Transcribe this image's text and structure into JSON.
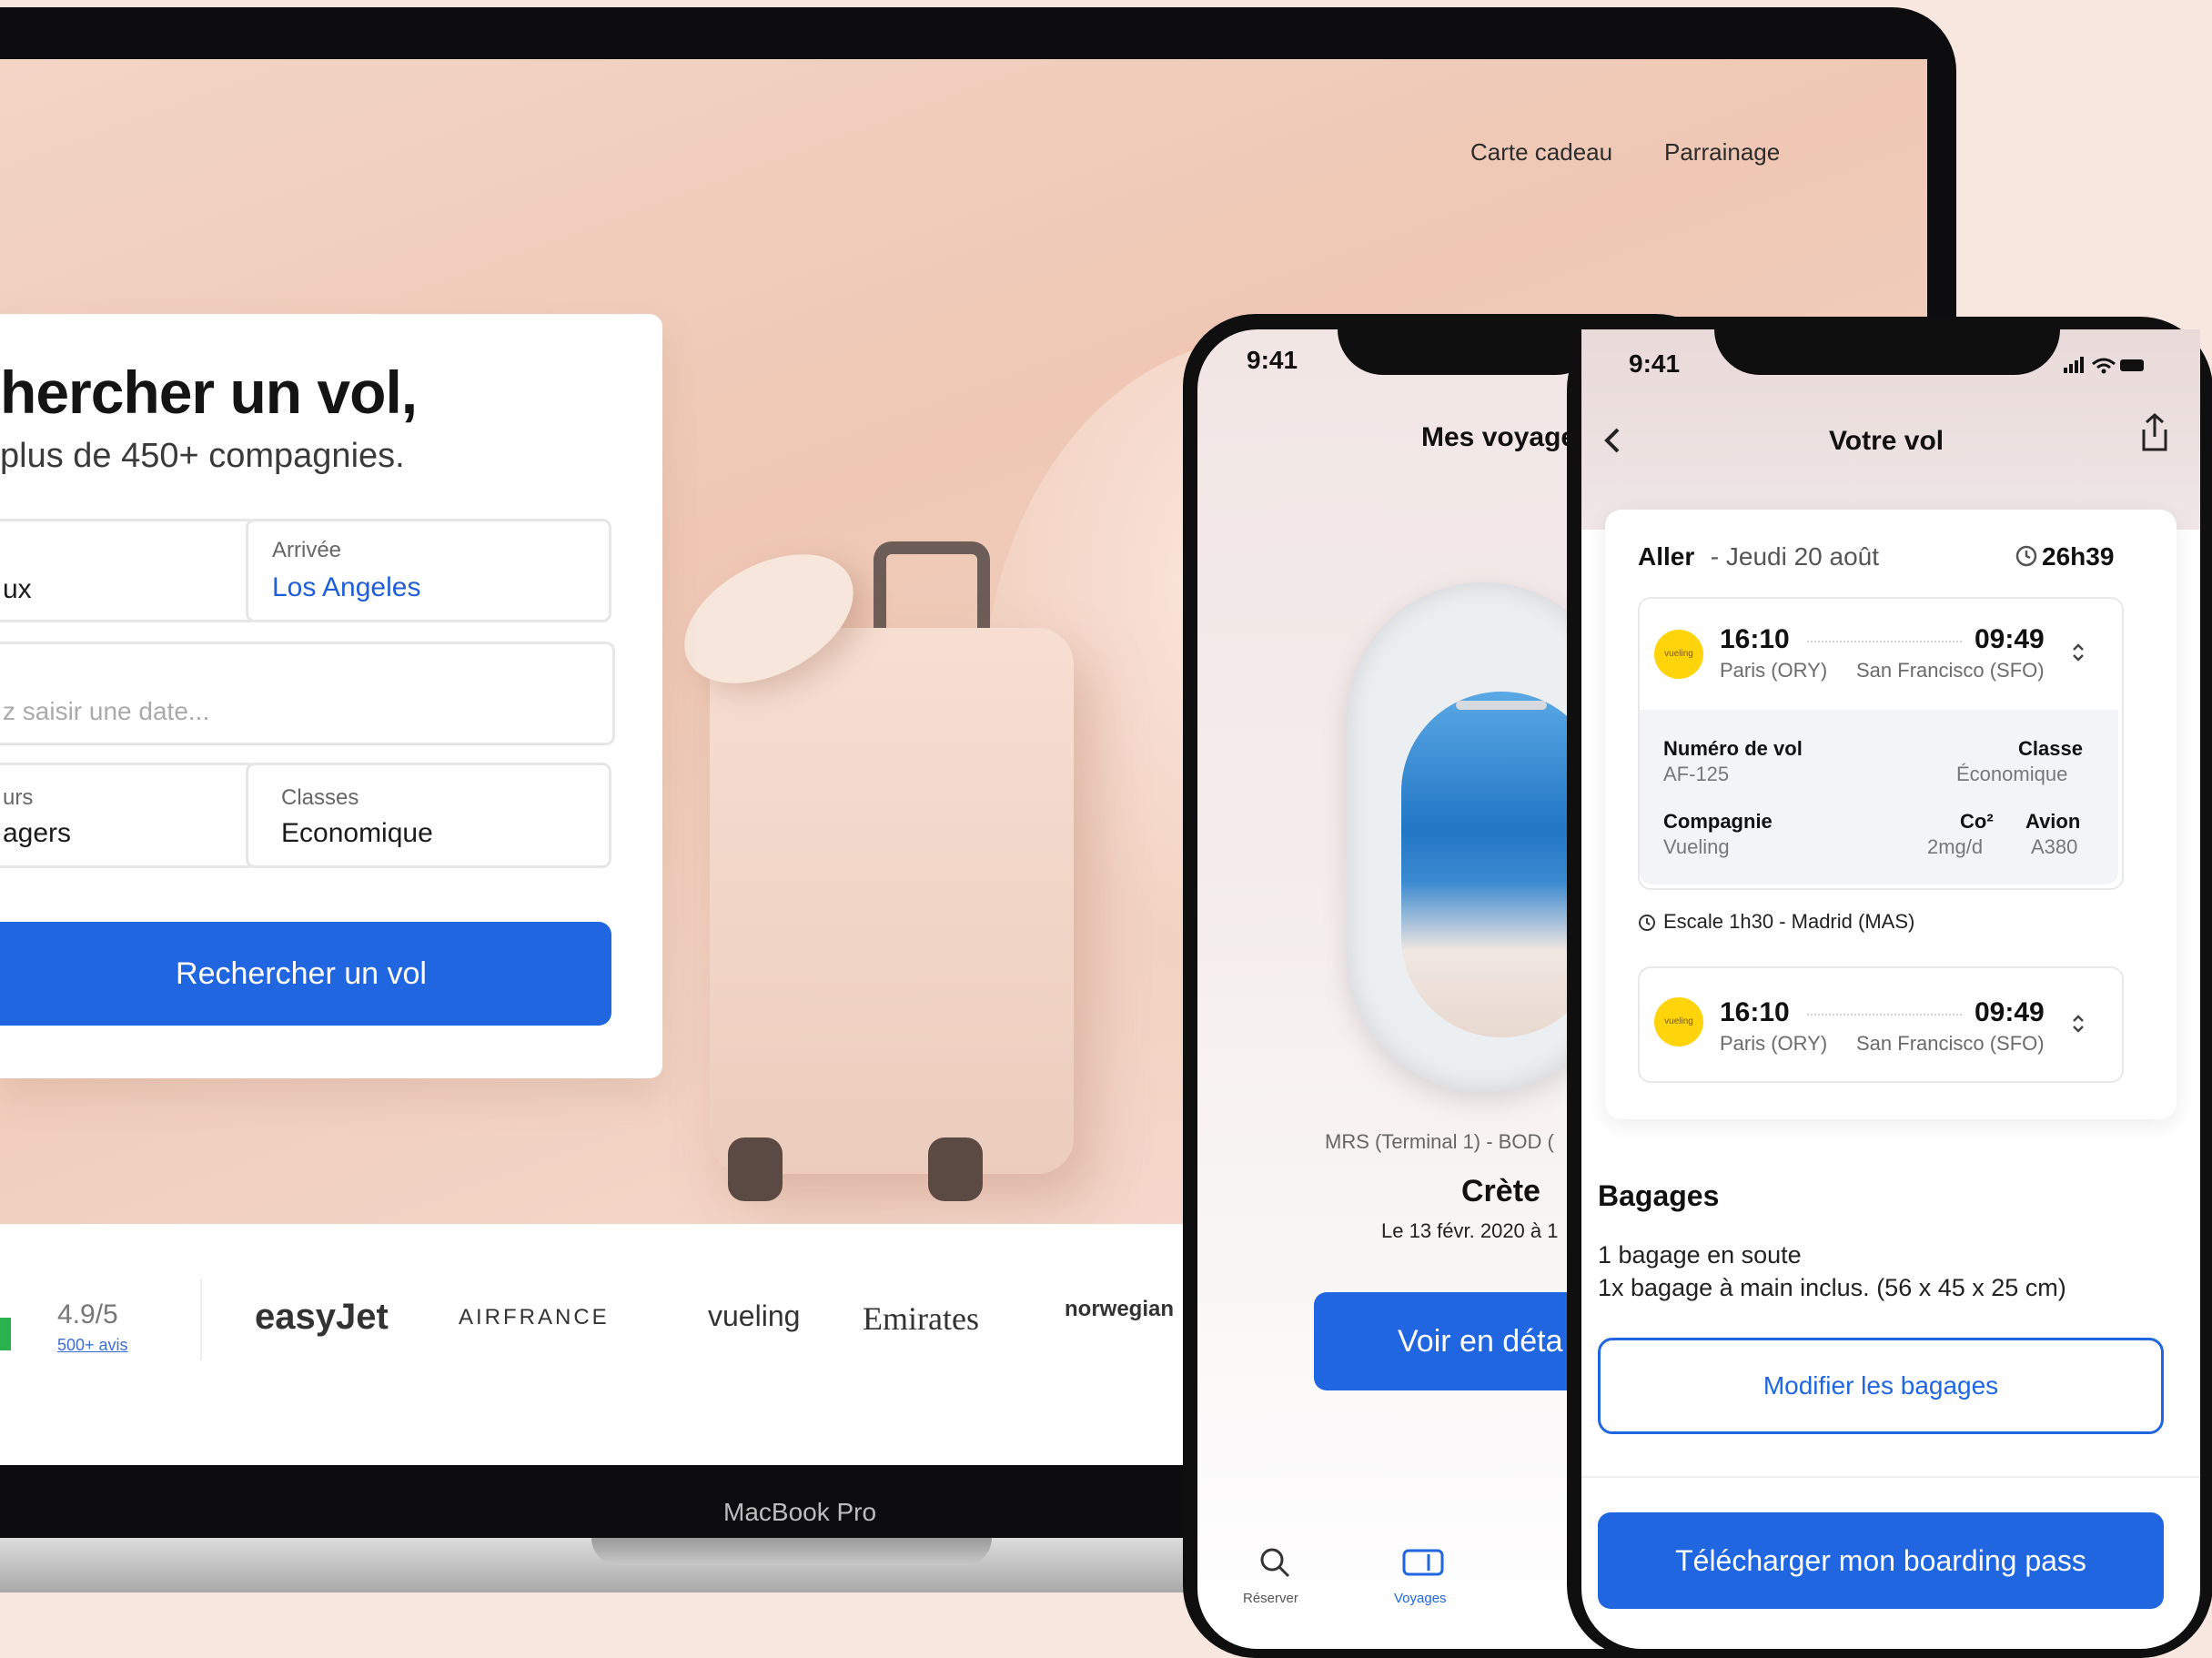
{
  "laptop": {
    "nav": {
      "gift_card": "Carte cadeau",
      "referral": "Parrainage"
    },
    "search": {
      "title": "hercher un vol,",
      "subtitle": "plus de 450+ compagnies.",
      "departure_value": "ux",
      "arrival_label": "Arrivée",
      "arrival_value": "Los Angeles",
      "date_placeholder": "z saisir une date...",
      "travellers_label": "urs",
      "travellers_value": "agers",
      "class_label": "Classes",
      "class_value": "Economique",
      "submit_label": "Rechercher un vol"
    },
    "rating": {
      "score": "4.9/5",
      "reviews": "500+ avis"
    },
    "logos": [
      "easyJet",
      "AIRFRANCE",
      "vueling",
      "Emirates",
      "norwegian"
    ],
    "device_label": "MacBook Pro"
  },
  "phone1": {
    "time": "9:41",
    "header_title": "Mes voyage",
    "route": "MRS (Terminal 1) - BOD (",
    "destination": "Crète",
    "date": "Le 13 févr. 2020 à 1",
    "detail_button": "Voir en déta",
    "tabs": {
      "book": "Réserver",
      "trips": "Voyages"
    },
    "icons": {
      "book": "search-icon",
      "trips": "ticket-icon"
    }
  },
  "phone2": {
    "time": "9:41",
    "header_title": "Votre vol",
    "outbound": {
      "label": "Aller",
      "date": " - Jeudi 20 août",
      "duration": "26h39"
    },
    "segment1": {
      "airline_badge": "vueling",
      "dep_time": "16:10",
      "arr_time": "09:49",
      "dep_city": "Paris (ORY)",
      "arr_city": "San Francisco (SFO)"
    },
    "details": {
      "flight_number_label": "Numéro de vol",
      "flight_number": "AF-125",
      "class_label": "Classe",
      "class_value": "Économique",
      "company_label": "Compagnie",
      "company_value": "Vueling",
      "co2_label": "Co²",
      "co2_value": "2mg/d",
      "aircraft_label": "Avion",
      "aircraft_value": "A380"
    },
    "stopover": "Escale 1h30 - Madrid (MAS)",
    "segment2": {
      "airline_badge": "vueling",
      "dep_time": "16:10",
      "arr_time": "09:49",
      "dep_city": "Paris (ORY)",
      "arr_city": "San Francisco (SFO)"
    },
    "baggage": {
      "title": "Bagages",
      "line1": "1 bagage en soute",
      "line2": "1x bagage à main inclus. (56 x 45 x 25 cm)",
      "modify_button": "Modifier les bagages"
    },
    "download_button": "Télécharger mon boarding pass"
  },
  "colors": {
    "primary": "#1f66e0",
    "vueling_yellow": "#ffd40a",
    "background": "#f8e7df"
  }
}
